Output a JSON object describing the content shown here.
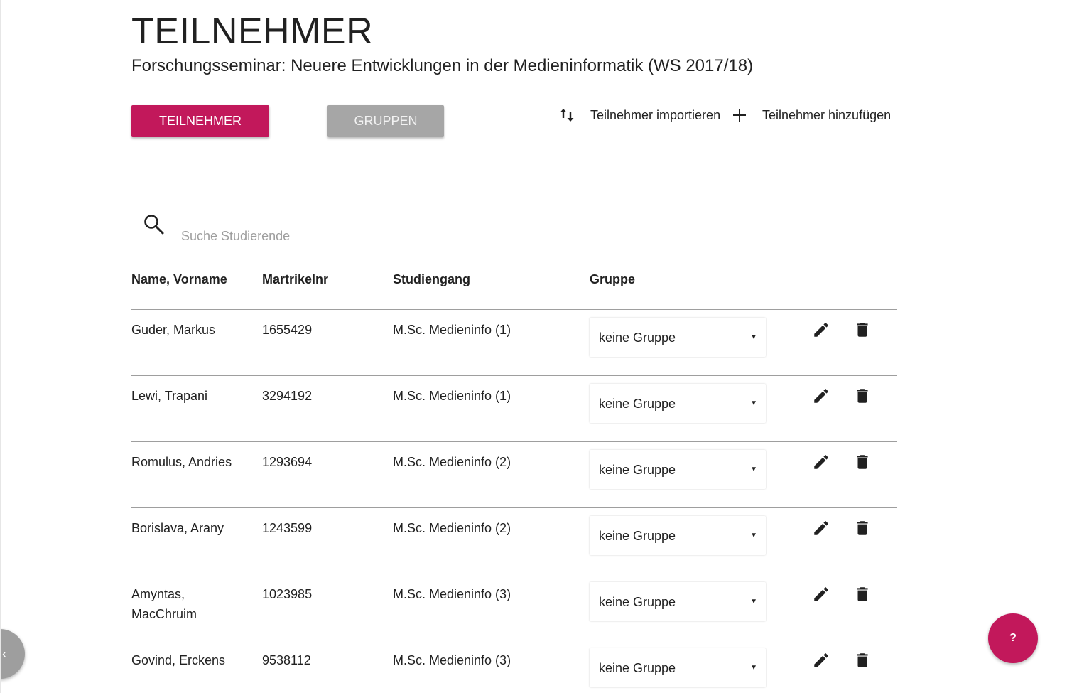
{
  "header": {
    "title": "TEILNEHMER",
    "subtitle": "Forschungsseminar: Neuere Entwicklungen in der Medieninformatik (WS 2017/18)"
  },
  "tabs": {
    "participants_label": "TEILNEHMER",
    "groups_label": "GRUPPEN"
  },
  "actions": {
    "import_label": "Teilnehmer importieren",
    "import_icon": "import-export-icon",
    "add_label": "Teilnehmer hinzufügen",
    "add_icon": "add-icon"
  },
  "search": {
    "placeholder": "Suche Studierende",
    "value": "",
    "icon": "search-icon"
  },
  "table": {
    "columns": [
      "Name, Vorname",
      "Martrikelnr",
      "Studiengang",
      "Gruppe"
    ],
    "rows": [
      {
        "name": "Guder, Markus",
        "number": "1655429",
        "program": "M.Sc. Medieninfo (1)",
        "group": "keine Gruppe"
      },
      {
        "name": "Lewi, Trapani",
        "number": "3294192",
        "program": "M.Sc. Medieninfo (1)",
        "group": "keine Gruppe"
      },
      {
        "name": "Romulus, Andries",
        "number": "1293694",
        "program": "M.Sc. Medieninfo (2)",
        "group": "keine Gruppe"
      },
      {
        "name": "Borislava, Arany",
        "number": "1243599",
        "program": "M.Sc. Medieninfo (2)",
        "group": "keine Gruppe"
      },
      {
        "name": "Amyntas, MacChruim",
        "number": "1023985",
        "program": "M.Sc. Medieninfo (3)",
        "group": "keine Gruppe"
      },
      {
        "name": "Govind, Erckens",
        "number": "9538112",
        "program": "M.Sc. Medieninfo (3)",
        "group": "keine Gruppe"
      }
    ]
  },
  "fabs": {
    "back_glyph": "‹",
    "help_glyph": "?"
  },
  "colors": {
    "accent": "#c2185b",
    "secondary_button": "#a6a6a6",
    "back_fab": "#9e9e9e"
  }
}
